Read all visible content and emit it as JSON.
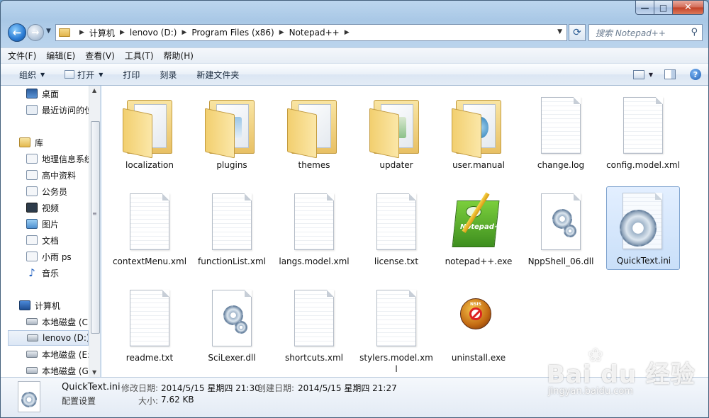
{
  "window": {
    "caption": {
      "minimize": "—",
      "maximize": "□",
      "close": "✕"
    }
  },
  "nav": {
    "back": "←",
    "forward": "→",
    "breadcrumb": [
      "计算机",
      "lenovo (D:)",
      "Program Files (x86)",
      "Notepad++"
    ],
    "search_placeholder": "搜索 Notepad++"
  },
  "menu": [
    "文件(F)",
    "编辑(E)",
    "查看(V)",
    "工具(T)",
    "帮助(H)"
  ],
  "toolbar": {
    "organize": "组织",
    "open": "打开",
    "print": "打印",
    "burn": "刻录",
    "new_folder": "新建文件夹",
    "help": "?"
  },
  "sidebar": {
    "items": [
      {
        "label": "桌面",
        "icon": "desktop-icon"
      },
      {
        "label": "最近访问的位置",
        "icon": "recent-places-icon"
      },
      {
        "label": "库",
        "icon": "library-icon"
      },
      {
        "label": "地理信息系统",
        "icon": "document-library-icon"
      },
      {
        "label": "高中资料",
        "icon": "document-library-icon"
      },
      {
        "label": "公务员",
        "icon": "document-library-icon"
      },
      {
        "label": "视频",
        "icon": "video-icon"
      },
      {
        "label": "图片",
        "icon": "picture-icon"
      },
      {
        "label": "文档",
        "icon": "document-icon"
      },
      {
        "label": "小雨 ps",
        "icon": "document-library-icon"
      },
      {
        "label": "音乐",
        "icon": "music-icon"
      },
      {
        "label": "计算机",
        "icon": "computer-icon"
      },
      {
        "label": "本地磁盘 (C:)",
        "icon": "drive-icon"
      },
      {
        "label": "lenovo (D:)",
        "icon": "drive-icon"
      },
      {
        "label": "本地磁盘 (E:)",
        "icon": "drive-icon"
      },
      {
        "label": "本地磁盘 (G:)",
        "icon": "drive-icon"
      }
    ]
  },
  "files": [
    {
      "name": "localization",
      "kind": "folder"
    },
    {
      "name": "plugins",
      "kind": "folder"
    },
    {
      "name": "themes",
      "kind": "folder"
    },
    {
      "name": "updater",
      "kind": "folder"
    },
    {
      "name": "user.manual",
      "kind": "folder"
    },
    {
      "name": "change.log",
      "kind": "document"
    },
    {
      "name": "config.model.xml",
      "kind": "document"
    },
    {
      "name": "contextMenu.xml",
      "kind": "document"
    },
    {
      "name": "functionList.xml",
      "kind": "document"
    },
    {
      "name": "langs.model.xml",
      "kind": "document"
    },
    {
      "name": "license.txt",
      "kind": "document"
    },
    {
      "name": "notepad++.exe",
      "kind": "notepad"
    },
    {
      "name": "NppShell_06.dll",
      "kind": "gear-doc"
    },
    {
      "name": "QuickText.ini",
      "kind": "gear"
    },
    {
      "name": "readme.txt",
      "kind": "document"
    },
    {
      "name": "SciLexer.dll",
      "kind": "gear-doc"
    },
    {
      "name": "shortcuts.xml",
      "kind": "document"
    },
    {
      "name": "stylers.model.xml",
      "kind": "document"
    },
    {
      "name": "uninstall.exe",
      "kind": "uninstall"
    }
  ],
  "details": {
    "name": "QuickText.ini",
    "type": "配置设置",
    "modified_label": "修改日期:",
    "modified_value": "2014/5/15 星期四 21:30",
    "created_label": "创建日期:",
    "created_value": "2014/5/15 星期四 21:27",
    "size_label": "大小:",
    "size_value": "7.62 KB"
  },
  "watermark": {
    "brand": "Bai du 经验",
    "url": "jingyan.baidu.com"
  }
}
